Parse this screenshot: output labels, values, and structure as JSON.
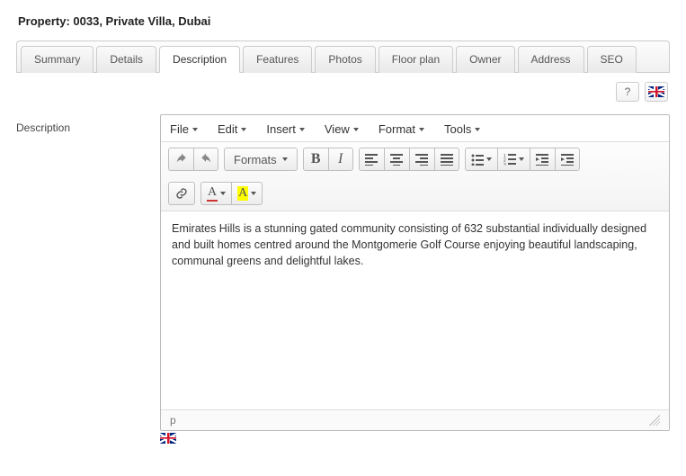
{
  "page_title": "Property: 0033, Private Villa, Dubai",
  "tabs": [
    {
      "label": "Summary"
    },
    {
      "label": "Details"
    },
    {
      "label": "Description",
      "active": true
    },
    {
      "label": "Features"
    },
    {
      "label": "Photos"
    },
    {
      "label": "Floor plan"
    },
    {
      "label": "Owner"
    },
    {
      "label": "Address"
    },
    {
      "label": "SEO"
    }
  ],
  "help_button_label": "?",
  "field_label": "Description",
  "editor": {
    "menubar": [
      "File",
      "Edit",
      "Insert",
      "View",
      "Format",
      "Tools"
    ],
    "formats_button": "Formats",
    "content": "Emirates Hills is a stunning gated community consisting of 632 substantial individually designed and built homes centred around the Montgomerie Golf Course enjoying beautiful landscaping, communal greens and delightful lakes.",
    "status_path": "p",
    "text_color_letter": "A",
    "bg_color_letter": "A",
    "bold_letter": "B",
    "italic_letter": "I"
  }
}
